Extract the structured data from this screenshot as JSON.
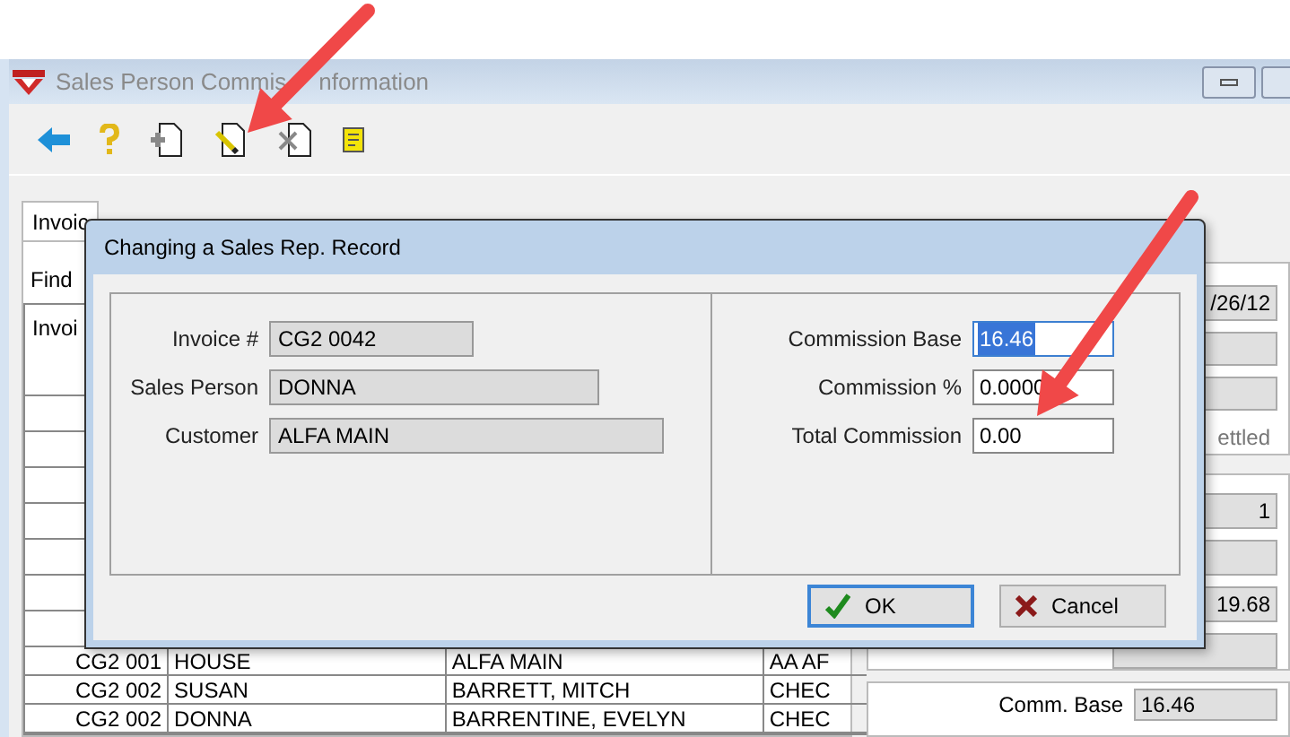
{
  "main_window": {
    "title_parts": [
      "Sales Person Commis",
      "nformation"
    ]
  },
  "tabs": [
    {
      "label": "Invoic",
      "selected": true
    }
  ],
  "find_label": "Find",
  "table": {
    "header": "Invoi",
    "rows": [
      [
        "CG2 001",
        "HOUSE",
        "ALFA MAIN",
        "AA AF"
      ],
      [
        "CG2 002",
        "SUSAN",
        "BARRETT, MITCH",
        "CHEC"
      ],
      [
        "CG2 002",
        "DONNA",
        "BARRENTINE, EVELYN",
        "CHEC"
      ]
    ]
  },
  "right_panel": {
    "date": "/26/12",
    "status": "ettled",
    "count": "1",
    "amount": "19.68",
    "comm_base_label": "Comm. Base",
    "comm_base": "16.46"
  },
  "dialog": {
    "title": "Changing a Sales Rep. Record",
    "left_fields": [
      {
        "label": "Invoice #",
        "value": "CG2 0042"
      },
      {
        "label": "Sales Person",
        "value": "DONNA"
      },
      {
        "label": "Customer",
        "value": "ALFA MAIN"
      }
    ],
    "right_fields": [
      {
        "label": "Commission Base",
        "value": "16.46",
        "selected": true
      },
      {
        "label": "Commission %",
        "value": "0.0000",
        "selected": false
      },
      {
        "label": "Total Commission",
        "value": "0.00",
        "selected": false
      }
    ],
    "buttons": [
      {
        "kind": "ok",
        "label": "OK",
        "default": true
      },
      {
        "kind": "cancel",
        "label": "Cancel",
        "default": false
      }
    ]
  }
}
